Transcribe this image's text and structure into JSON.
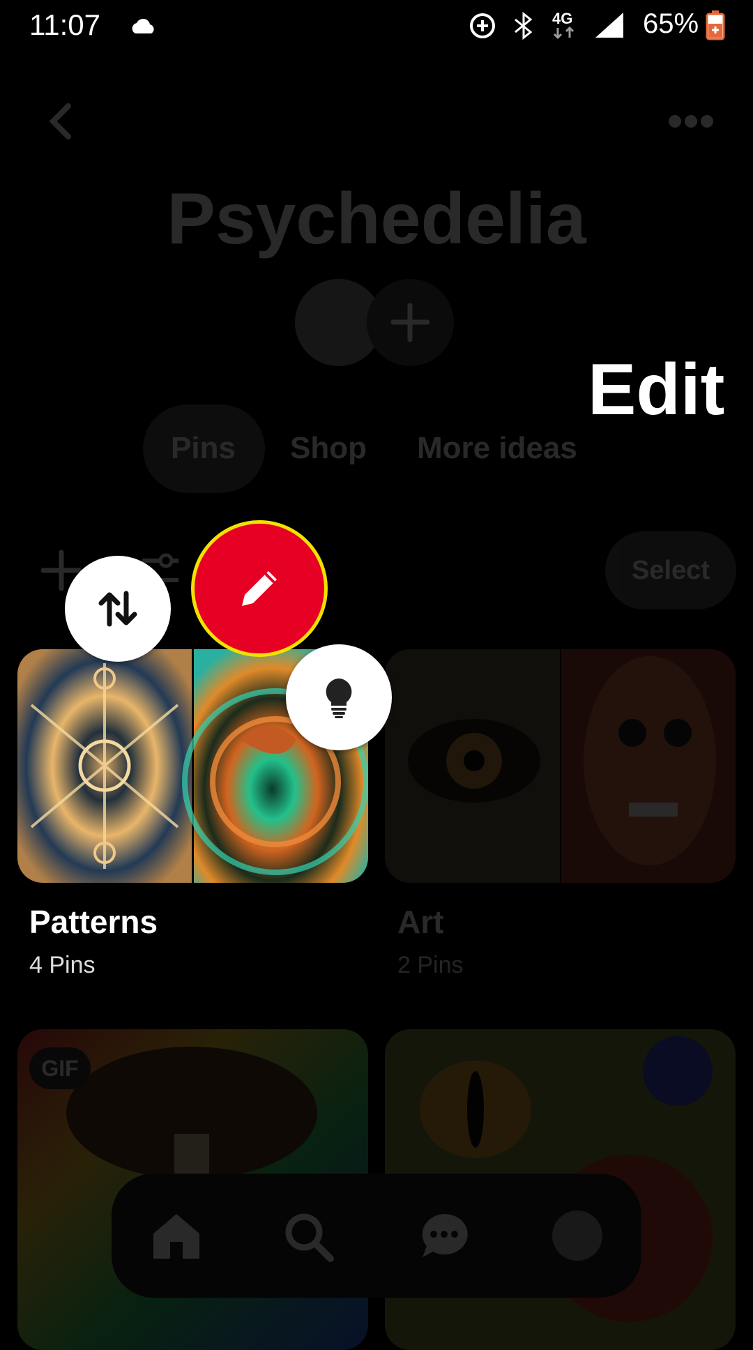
{
  "status_bar": {
    "time": "11:07",
    "battery": "65%",
    "network": "4G"
  },
  "header": {
    "back_icon": "chevron-left-icon",
    "more_icon": "ellipsis-icon"
  },
  "board": {
    "title": "Psychedelia"
  },
  "tabs": [
    {
      "label": "Pins",
      "selected": true
    },
    {
      "label": "Shop",
      "selected": false
    },
    {
      "label": "More ideas",
      "selected": false
    }
  ],
  "toolbar": {
    "select_label": "Select"
  },
  "edit_overlay": {
    "label": "Edit"
  },
  "sections": [
    {
      "name": "Patterns",
      "count": "4 Pins"
    },
    {
      "name": "Art",
      "count": "2 Pins"
    }
  ],
  "pins": {
    "gif_badge": "GIF"
  },
  "colors": {
    "accent_red": "#e60023",
    "highlight_yellow": "#f2e200",
    "background": "#000000"
  }
}
